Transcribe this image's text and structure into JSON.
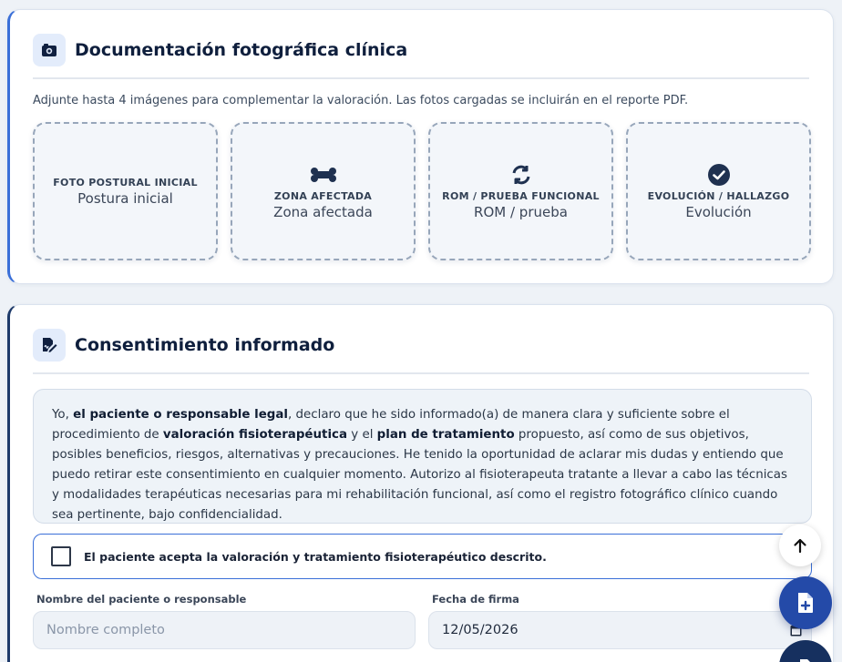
{
  "photo_section": {
    "title": "Documentación fotográfica clínica",
    "subtitle": "Adjunte hasta 4 imágenes para complementar la valoración. Las fotos cargadas se incluirán en el reporte PDF.",
    "icon": "camera-icon",
    "slots": [
      {
        "label": "FOTO POSTURAL INICIAL",
        "sub": "Postura inicial",
        "icon": ""
      },
      {
        "label": "ZONA AFECTADA",
        "sub": "Zona afectada",
        "icon": "bone-icon"
      },
      {
        "label": "ROM / PRUEBA FUNCIONAL",
        "sub": "ROM / prueba",
        "icon": "sync-icon"
      },
      {
        "label": "EVOLUCIÓN / HALLAZGO",
        "sub": "Evolución",
        "icon": "check-circle-icon"
      }
    ]
  },
  "consent_section": {
    "title": "Consentimiento informado",
    "icon": "signature-icon",
    "text_1": "Yo, ",
    "bold_1": "el paciente o responsable legal",
    "text_2": ", declaro que he sido informado(a) de manera clara y suficiente sobre el procedimiento de ",
    "bold_2": "valoración fisioterapéutica",
    "text_3": " y el ",
    "bold_3": "plan de tratamiento",
    "text_4": " propuesto, así como de sus objetivos, posibles beneficios, riesgos, alternativas y precauciones. He tenido la oportunidad de aclarar mis dudas y entiendo que puedo retirar este consentimiento en cualquier momento. Autorizo al fisioterapeuta tratante a llevar a cabo las técnicas y modalidades terapéuticas necesarias para mi rehabilitación funcional, así como el registro fotográfico clínico cuando sea pertinente, bajo confidencialidad.",
    "accept_label": "El paciente acepta la valoración y tratamiento fisioterapéutico descrito.",
    "accept_checked": false,
    "name_label": "Nombre del paciente o responsable",
    "name_placeholder": "Nombre completo",
    "date_label": "Fecha de firma",
    "date_value": "12/05/2026"
  },
  "colors": {
    "accent": "#3a6fd8",
    "primary_dark": "#16305f",
    "fab_blue": "#244aa8"
  }
}
